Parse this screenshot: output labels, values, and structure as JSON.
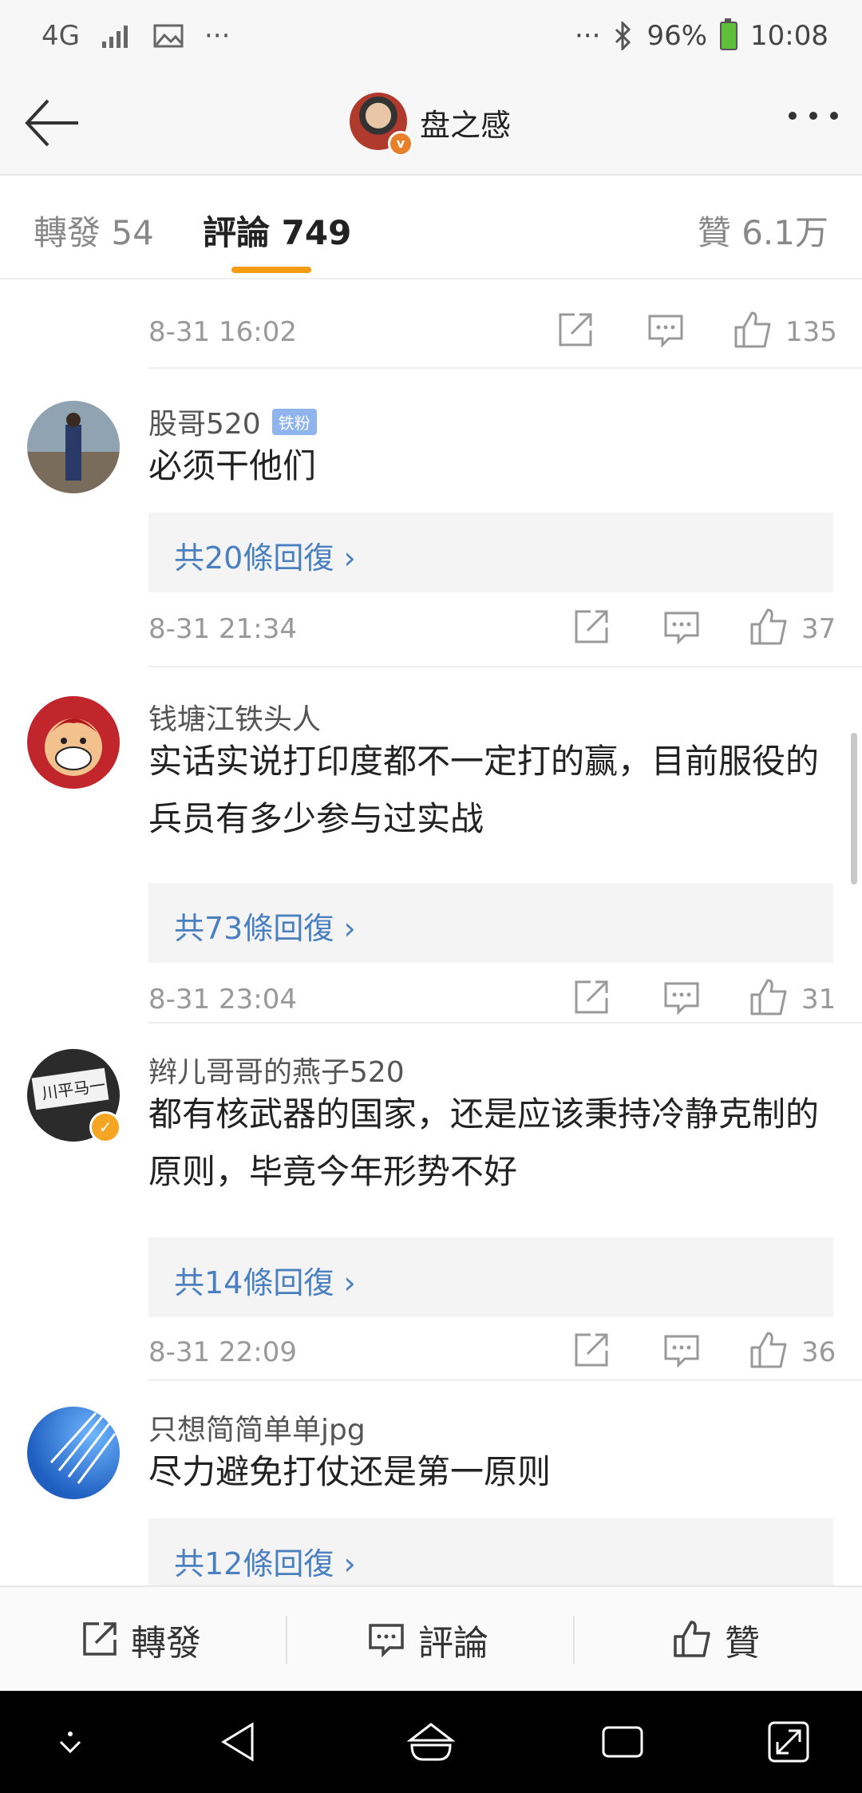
{
  "status_bar": {
    "network": "4G",
    "extra": "···",
    "right_extra": "···",
    "battery": "96%",
    "time": "10:08"
  },
  "nav": {
    "title": "盘之感",
    "back_icon": "back-arrow-icon",
    "more_icon": "more-dots-icon"
  },
  "tabs": [
    {
      "label": "轉發 54"
    },
    {
      "label": "評論 749"
    },
    {
      "label": "贊 6.1万"
    }
  ],
  "top_meta": {
    "time": "8-31 16:02",
    "likes": "135"
  },
  "comments": [
    {
      "username": "股哥520",
      "badge": "铁粉",
      "text": "必须干他们",
      "replies": "共20條回復",
      "time": "8-31 21:34",
      "likes": "37"
    },
    {
      "username": "钱塘江铁头人",
      "text": "实话实说打印度都不一定打的赢，目前服役的兵员有多少参与过实战",
      "replies": "共73條回復",
      "time": "8-31 23:04",
      "likes": "31"
    },
    {
      "username": "辫儿哥哥的燕子520",
      "text": "都有核武器的国家，还是应该秉持冷静克制的原则，毕竟今年形势不好",
      "replies": "共14條回復",
      "time": "8-31 22:09",
      "likes": "36"
    },
    {
      "username": "只想简简单单jpg",
      "text": "尽力避免打仗还是第一原则",
      "replies": "共12條回復"
    }
  ],
  "bottom_bar": {
    "repost": "轉發",
    "comment": "評論",
    "like": "贊"
  },
  "colors": {
    "accent": "#f39c12",
    "link": "#4a7fc0",
    "reply_bg": "#f4f4f4"
  }
}
